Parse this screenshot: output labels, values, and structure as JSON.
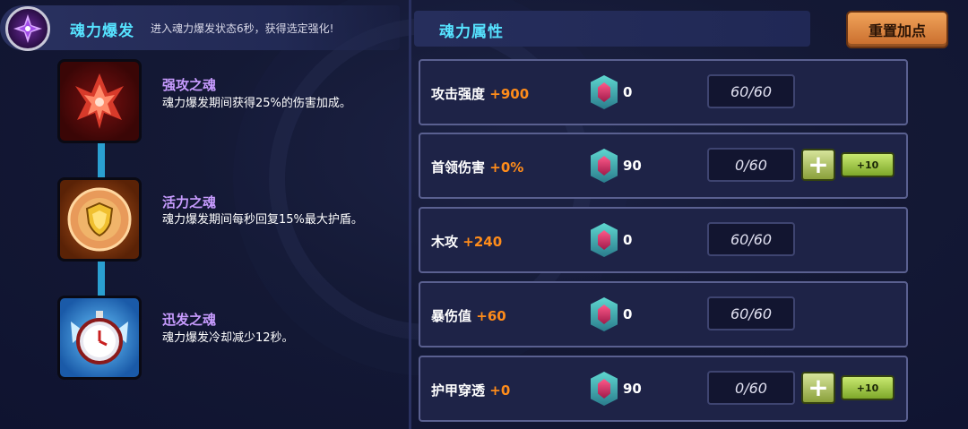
{
  "burst": {
    "icon": "purple-crystal-icon",
    "title": "魂力爆发",
    "description": "进入魂力爆发状态6秒，获得选定强化!"
  },
  "souls": [
    {
      "icon": "red-attack-soul-icon",
      "name": "强攻之魂",
      "description": "魂力爆发期间获得25%的伤害加成。"
    },
    {
      "icon": "shield-vitality-soul-icon",
      "name": "活力之魂",
      "description": "魂力爆发期间每秒回复15%最大护盾。"
    },
    {
      "icon": "stopwatch-speed-soul-icon",
      "name": "迅发之魂",
      "description": "魂力爆发冷却减少12秒。"
    }
  ],
  "attributes": {
    "title": "魂力属性",
    "reset_label": "重置加点",
    "rows": [
      {
        "label": "攻击强度",
        "bonus": "+900",
        "gems": "0",
        "level": "60/60",
        "can_add": false
      },
      {
        "label": "首领伤害",
        "bonus": "+0%",
        "gems": "90",
        "level": "0/60",
        "can_add": true,
        "plus_label": "+",
        "plus10_label": "+10"
      },
      {
        "label": "木攻",
        "bonus": "+240",
        "gems": "0",
        "level": "60/60",
        "can_add": false
      },
      {
        "label": "暴伤值",
        "bonus": "+60",
        "gems": "0",
        "level": "60/60",
        "can_add": false
      },
      {
        "label": "护甲穿透",
        "bonus": "+0",
        "gems": "90",
        "level": "0/60",
        "can_add": true,
        "plus_label": "+",
        "plus10_label": "+10"
      }
    ]
  },
  "colors": {
    "accent_cyan": "#56e3ff",
    "bonus_orange": "#ff8c1a",
    "soul_name_purple": "#c89cff",
    "reset_orange": "#e08a44",
    "plus_green": "#a8c050"
  }
}
